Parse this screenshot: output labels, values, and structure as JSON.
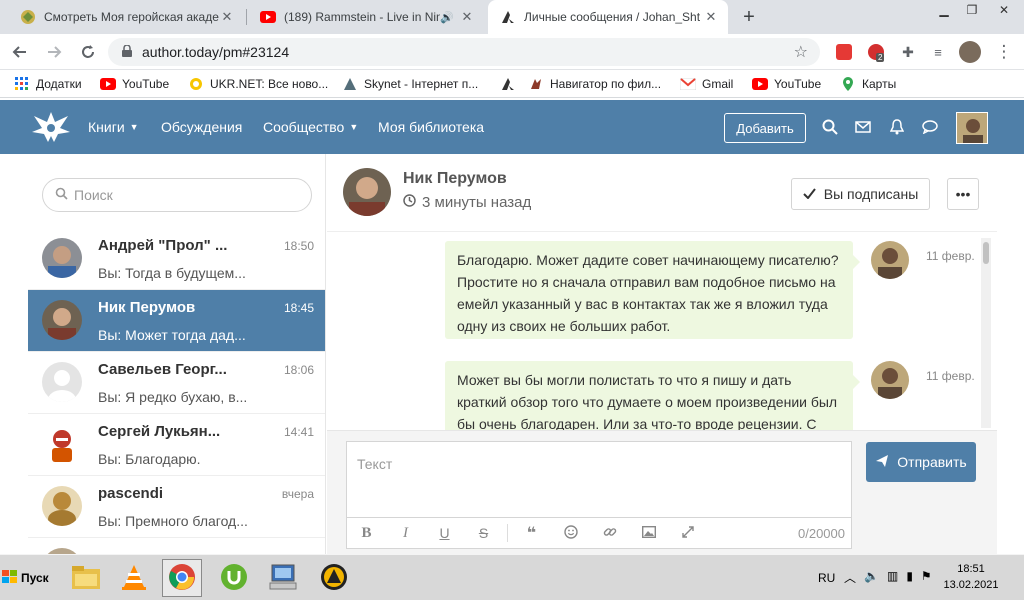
{
  "browser": {
    "tabs": [
      {
        "title": "Смотреть Моя геройская акаде",
        "icon": "anime-icon",
        "active": false
      },
      {
        "title": "(189) Rammstein - Live in Nim",
        "icon": "youtube-icon",
        "active": false
      },
      {
        "title": "Личные сообщения / Johan_Sht",
        "icon": "author-today-icon",
        "active": true
      }
    ],
    "new_tab": "+",
    "url": "author.today/pm#23124",
    "bookmarks": [
      {
        "label": "Додатки",
        "icon": "apps-grid-icon"
      },
      {
        "label": "YouTube",
        "icon": "youtube-icon"
      },
      {
        "label": "UKR.NET: Все ново...",
        "icon": "ukrnet-icon"
      },
      {
        "label": "Skynet - Інтернет п...",
        "icon": "skynet-icon"
      },
      {
        "label": "",
        "icon": "author-today-icon"
      },
      {
        "label": "Навигатор по фил...",
        "icon": "navigator-icon"
      },
      {
        "label": "Gmail",
        "icon": "gmail-icon"
      },
      {
        "label": "YouTube",
        "icon": "youtube-icon"
      },
      {
        "label": "Карты",
        "icon": "maps-icon"
      }
    ],
    "extension_badge": "2"
  },
  "site": {
    "menu": [
      {
        "label": "Книги",
        "dropdown": true
      },
      {
        "label": "Обсуждения",
        "dropdown": false
      },
      {
        "label": "Сообщество",
        "dropdown": true
      },
      {
        "label": "Моя библиотека",
        "dropdown": false
      }
    ],
    "add_button": "Добавить",
    "accent_color": "#4f7fa8"
  },
  "sidebar": {
    "search_placeholder": "Поиск",
    "conversations": [
      {
        "name": "Андрей \"Прол\" ...",
        "time": "18:50",
        "preview": "Вы: Тогда в будущем...",
        "selected": false,
        "avatar": "andrey"
      },
      {
        "name": "Ник Перумов",
        "time": "18:45",
        "preview": "Вы: Может тогда дад...",
        "selected": true,
        "avatar": "nik"
      },
      {
        "name": "Савельев Георг...",
        "time": "18:06",
        "preview": "Вы: Я редко бухаю, в...",
        "selected": false,
        "avatar": "default"
      },
      {
        "name": "Сергей Лукьян...",
        "time": "14:41",
        "preview": "Вы: Благодарю.",
        "selected": false,
        "avatar": "sergey"
      },
      {
        "name": "pascendi",
        "time": "вчера",
        "preview": "Вы: Премного благод...",
        "selected": false,
        "avatar": "pascendi"
      }
    ]
  },
  "chat": {
    "header": {
      "name": "Ник Перумов",
      "status": "3 минуты назад",
      "subscribe_label": "Вы подписаны",
      "more_label": "•••"
    },
    "messages": [
      {
        "text": "Благодарю. Может дадите совет начинающему писателю? Простите но я сначала отправил вам подобное письмо на емейл указанный у вас в контактах так же я вложил туда одну из своих не больших работ.",
        "date": "11 февр."
      },
      {
        "text": "Может вы бы могли полистать то что я пишу и дать краткий обзор того что думаете о моем произведении был бы очень благодарен. Или за что-то вроде рецензии. С",
        "date": "11 февр."
      }
    ],
    "composer": {
      "placeholder": "Текст",
      "counter": "0/20000",
      "send_label": "Отправить",
      "toolbar": {
        "bold": "B",
        "italic": "I",
        "underline": "U",
        "strike": "S"
      }
    }
  },
  "taskbar": {
    "start_label": "Пуск",
    "language": "RU",
    "time": "18:51",
    "date": "13.02.2021"
  }
}
